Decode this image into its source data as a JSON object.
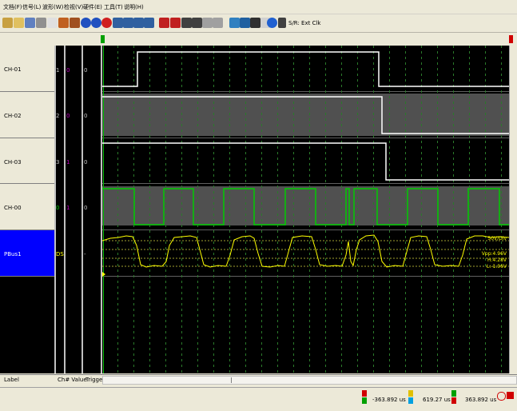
{
  "menu": [
    "文档(F)",
    "信号(L)",
    "波形(W)",
    "检视(V)",
    "硬件(E)",
    "工具(T)",
    "说明(H)"
  ],
  "toolbar": {
    "status": "S/R: Ext Clk",
    "icons": [
      "probe-icon",
      "open-icon",
      "save-icon",
      "print-icon",
      "copy-icon",
      "stop-icon",
      "run-icon",
      "play-icon",
      "record-icon",
      "zoom-in-icon",
      "zoom-out-icon",
      "search-icon",
      "trigger-icon",
      "signal-icon",
      "settings-icon",
      "grid-icon",
      "list-icon",
      "help-icon",
      "info-icon"
    ]
  },
  "channels": [
    {
      "label": "CH-01",
      "ch": "1",
      "value": "0",
      "trigger": "0"
    },
    {
      "label": "CH-02",
      "ch": "2",
      "value": "0",
      "trigger": "0"
    },
    {
      "label": "CH-03",
      "ch": "3",
      "value": "1",
      "trigger": "0"
    },
    {
      "label": "CH-00",
      "ch": "0",
      "value": "1",
      "trigger": "0"
    },
    {
      "label": "PBus1",
      "ch": "DSO",
      "value": "",
      "trigger": "-"
    }
  ],
  "dso": {
    "scale": "50V/Div",
    "vpp": "Vpp:4.96V",
    "high": "H:4.28V",
    "low": "L:-1.06V"
  },
  "bottom_tabs": {
    "label": "Label",
    "chvalue": "Ch# Value",
    "trigger": "Trigger"
  },
  "status": {
    "a_value": "-363.892 us",
    "b_value": "619.27 us",
    "c_value": "363.892 us"
  },
  "colors": {
    "accent_blue": "#0000ff",
    "wave_white": "#ffffff",
    "wave_green": "#00cc00",
    "wave_yellow": "#ffff00",
    "gray_fill": "#505050"
  }
}
